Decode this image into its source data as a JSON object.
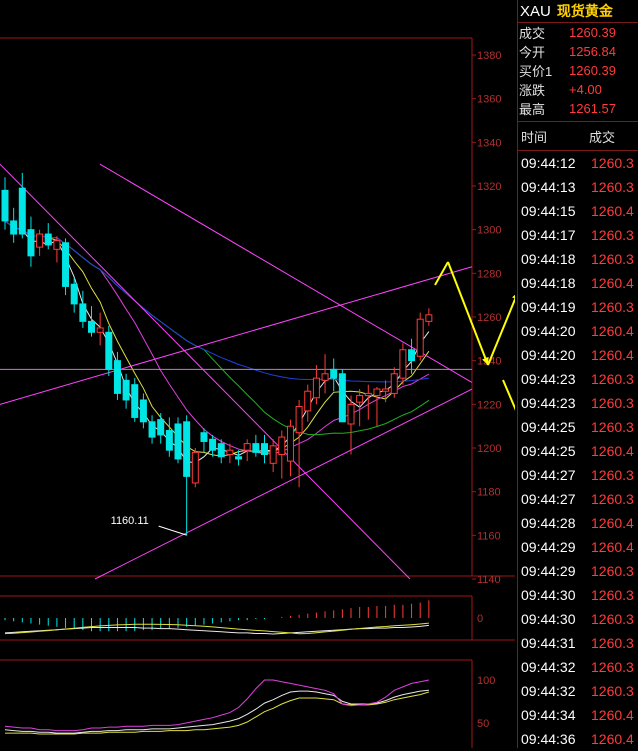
{
  "quote": {
    "symbol": "XAU",
    "name": "现货黄金",
    "rows": [
      {
        "label": "成交",
        "value": "1260.39"
      },
      {
        "label": "今开",
        "value": "1256.84"
      },
      {
        "label": "买价1",
        "value": "1260.39"
      },
      {
        "label": "涨跌",
        "value": "+4.00"
      },
      {
        "label": "最高",
        "value": "1261.57"
      }
    ]
  },
  "ticks": {
    "header_time": "时间",
    "header_price": "成交",
    "rows": [
      {
        "time": "09:44:12",
        "price": "1260.3"
      },
      {
        "time": "09:44:13",
        "price": "1260.3"
      },
      {
        "time": "09:44:15",
        "price": "1260.4"
      },
      {
        "time": "09:44:17",
        "price": "1260.3"
      },
      {
        "time": "09:44:18",
        "price": "1260.3"
      },
      {
        "time": "09:44:18",
        "price": "1260.4"
      },
      {
        "time": "09:44:19",
        "price": "1260.3"
      },
      {
        "time": "09:44:20",
        "price": "1260.4"
      },
      {
        "time": "09:44:20",
        "price": "1260.4"
      },
      {
        "time": "09:44:23",
        "price": "1260.3"
      },
      {
        "time": "09:44:23",
        "price": "1260.3"
      },
      {
        "time": "09:44:25",
        "price": "1260.3"
      },
      {
        "time": "09:44:25",
        "price": "1260.4"
      },
      {
        "time": "09:44:27",
        "price": "1260.3"
      },
      {
        "time": "09:44:27",
        "price": "1260.3"
      },
      {
        "time": "09:44:28",
        "price": "1260.4"
      },
      {
        "time": "09:44:29",
        "price": "1260.4"
      },
      {
        "time": "09:44:29",
        "price": "1260.3"
      },
      {
        "time": "09:44:30",
        "price": "1260.3"
      },
      {
        "time": "09:44:30",
        "price": "1260.3"
      },
      {
        "time": "09:44:31",
        "price": "1260.3"
      },
      {
        "time": "09:44:32",
        "price": "1260.3"
      },
      {
        "time": "09:44:32",
        "price": "1260.3"
      },
      {
        "time": "09:44:34",
        "price": "1260.4"
      },
      {
        "time": "09:44:36",
        "price": "1260.4"
      }
    ]
  },
  "colors": {
    "up": "#ff3b3b",
    "down": "#00e5e5",
    "grid_border": "#a01818",
    "axis_text": "#b03030",
    "arrow": "#ffff00",
    "ma_white": "#e8e8e8",
    "ma_yellow": "#e0e040",
    "ma_magenta": "#e040e0",
    "ma_green": "#20b020",
    "ma_blue": "#2040e0",
    "trendline": "#ff44ff"
  },
  "chart_data": {
    "type": "candlestick",
    "title": "",
    "xlabel": "",
    "ylabel": "",
    "ylim": [
      1140,
      1386
    ],
    "y_ticks": [
      1140,
      1160,
      1180,
      1200,
      1220,
      1240,
      1260,
      1280,
      1300,
      1320,
      1340,
      1360,
      1380
    ],
    "low_annotation": {
      "label": "1160.11",
      "value": 1160.11,
      "candle_index": 21
    },
    "candles": [
      {
        "o": 1318,
        "h": 1324,
        "l": 1300,
        "c": 1304
      },
      {
        "o": 1304,
        "h": 1310,
        "l": 1294,
        "c": 1298
      },
      {
        "o": 1319,
        "h": 1326,
        "l": 1296,
        "c": 1298
      },
      {
        "o": 1300,
        "h": 1306,
        "l": 1283,
        "c": 1288
      },
      {
        "o": 1292,
        "h": 1300,
        "l": 1288,
        "c": 1298
      },
      {
        "o": 1298,
        "h": 1303,
        "l": 1291,
        "c": 1293
      },
      {
        "o": 1291,
        "h": 1297,
        "l": 1285,
        "c": 1295
      },
      {
        "o": 1294,
        "h": 1296,
        "l": 1270,
        "c": 1274
      },
      {
        "o": 1275,
        "h": 1278,
        "l": 1262,
        "c": 1266
      },
      {
        "o": 1266,
        "h": 1272,
        "l": 1255,
        "c": 1258
      },
      {
        "o": 1258,
        "h": 1265,
        "l": 1251,
        "c": 1253
      },
      {
        "o": 1253,
        "h": 1262,
        "l": 1247,
        "c": 1255
      },
      {
        "o": 1253,
        "h": 1256,
        "l": 1233,
        "c": 1236
      },
      {
        "o": 1240,
        "h": 1244,
        "l": 1222,
        "c": 1225
      },
      {
        "o": 1231,
        "h": 1234,
        "l": 1218,
        "c": 1222
      },
      {
        "o": 1229,
        "h": 1232,
        "l": 1212,
        "c": 1214
      },
      {
        "o": 1222,
        "h": 1225,
        "l": 1209,
        "c": 1212
      },
      {
        "o": 1212,
        "h": 1215,
        "l": 1202,
        "c": 1205
      },
      {
        "o": 1213,
        "h": 1216,
        "l": 1202,
        "c": 1206
      },
      {
        "o": 1208,
        "h": 1214,
        "l": 1196,
        "c": 1199
      },
      {
        "o": 1211,
        "h": 1214,
        "l": 1193,
        "c": 1195
      },
      {
        "o": 1212,
        "h": 1215,
        "l": 1160,
        "c": 1187
      },
      {
        "o": 1184,
        "h": 1200,
        "l": 1182,
        "c": 1198
      },
      {
        "o": 1207,
        "h": 1209,
        "l": 1198,
        "c": 1203
      },
      {
        "o": 1204,
        "h": 1206,
        "l": 1196,
        "c": 1199
      },
      {
        "o": 1202,
        "h": 1204,
        "l": 1193,
        "c": 1196
      },
      {
        "o": 1197,
        "h": 1202,
        "l": 1193,
        "c": 1199
      },
      {
        "o": 1196,
        "h": 1199,
        "l": 1192,
        "c": 1195
      },
      {
        "o": 1199,
        "h": 1204,
        "l": 1194,
        "c": 1202
      },
      {
        "o": 1202,
        "h": 1206,
        "l": 1196,
        "c": 1198
      },
      {
        "o": 1202,
        "h": 1206,
        "l": 1193,
        "c": 1197
      },
      {
        "o": 1193,
        "h": 1204,
        "l": 1189,
        "c": 1201
      },
      {
        "o": 1197,
        "h": 1208,
        "l": 1186,
        "c": 1205
      },
      {
        "o": 1194,
        "h": 1213,
        "l": 1187,
        "c": 1210
      },
      {
        "o": 1207,
        "h": 1222,
        "l": 1182,
        "c": 1219
      },
      {
        "o": 1217,
        "h": 1229,
        "l": 1212,
        "c": 1226
      },
      {
        "o": 1223,
        "h": 1238,
        "l": 1220,
        "c": 1232
      },
      {
        "o": 1231,
        "h": 1243,
        "l": 1225,
        "c": 1234
      },
      {
        "o": 1236,
        "h": 1241,
        "l": 1226,
        "c": 1232
      },
      {
        "o": 1234,
        "h": 1236,
        "l": 1216,
        "c": 1212
      },
      {
        "o": 1211,
        "h": 1224,
        "l": 1197,
        "c": 1220
      },
      {
        "o": 1221,
        "h": 1227,
        "l": 1210,
        "c": 1224
      },
      {
        "o": 1224,
        "h": 1229,
        "l": 1213,
        "c": 1225
      },
      {
        "o": 1224,
        "h": 1228,
        "l": 1210,
        "c": 1227
      },
      {
        "o": 1226,
        "h": 1231,
        "l": 1221,
        "c": 1227
      },
      {
        "o": 1225,
        "h": 1237,
        "l": 1223,
        "c": 1234
      },
      {
        "o": 1232,
        "h": 1248,
        "l": 1229,
        "c": 1245
      },
      {
        "o": 1245,
        "h": 1250,
        "l": 1234,
        "c": 1240
      },
      {
        "o": 1242,
        "h": 1262,
        "l": 1240,
        "c": 1259
      },
      {
        "o": 1258,
        "h": 1264,
        "l": 1256,
        "c": 1261
      }
    ],
    "macd_histogram": [
      -2,
      -3,
      -4,
      -5,
      -6,
      -7,
      -8,
      -9,
      -10,
      -11,
      -12,
      -12,
      -12,
      -12,
      -12,
      -12,
      -11,
      -11,
      -10,
      -10,
      -9,
      -8,
      -7,
      -6,
      -5,
      -4,
      -3,
      -2,
      -2,
      -1,
      -1,
      0,
      1,
      2,
      3,
      4,
      5,
      6,
      7,
      8,
      9,
      10,
      10,
      11,
      11,
      12,
      12,
      13,
      14,
      16
    ],
    "osc_series": {
      "white": [
        42,
        41,
        40,
        40,
        39,
        39,
        38,
        38,
        38,
        39,
        40,
        40,
        41,
        41,
        42,
        42,
        42,
        43,
        43,
        43,
        44,
        45,
        46,
        47,
        48,
        50,
        52,
        55,
        60,
        66,
        73,
        77,
        82,
        86,
        87,
        87,
        86,
        84,
        82,
        75,
        72,
        72,
        72,
        73,
        76,
        80,
        83,
        85,
        87,
        88
      ],
      "yellow": [
        38,
        38,
        38,
        38,
        37,
        37,
        37,
        37,
        37,
        38,
        38,
        38,
        39,
        39,
        39,
        39,
        40,
        40,
        40,
        41,
        41,
        41,
        42,
        42,
        43,
        44,
        45,
        47,
        51,
        57,
        63,
        67,
        72,
        76,
        79,
        79,
        79,
        78,
        77,
        72,
        71,
        71,
        71,
        72,
        74,
        77,
        79,
        81,
        83,
        86
      ],
      "magenta": [
        46,
        45,
        44,
        44,
        42,
        42,
        41,
        41,
        41,
        42,
        44,
        44,
        45,
        45,
        46,
        46,
        46,
        47,
        47,
        47,
        48,
        50,
        52,
        54,
        56,
        59,
        62,
        68,
        78,
        90,
        100,
        100,
        98,
        96,
        94,
        92,
        90,
        88,
        84,
        72,
        70,
        71,
        72,
        74,
        80,
        88,
        92,
        96,
        98,
        100
      ]
    },
    "osc_ticks": [
      50,
      100
    ]
  }
}
